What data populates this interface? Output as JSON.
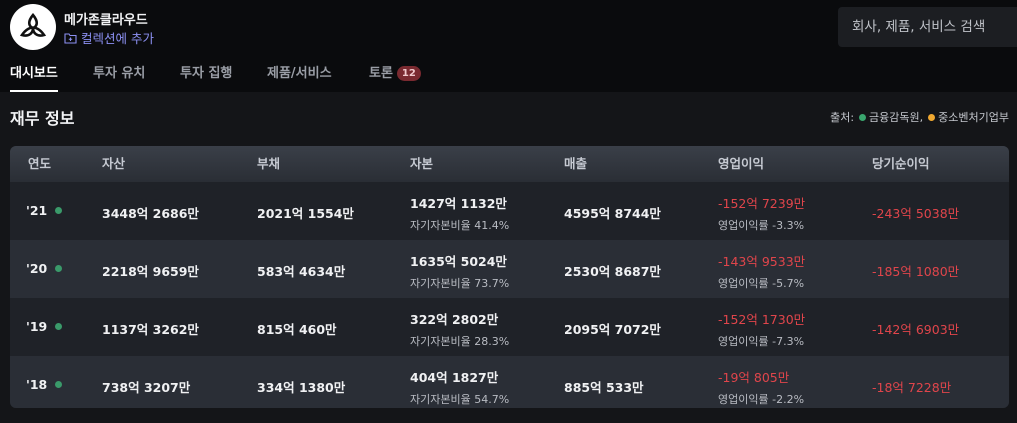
{
  "header": {
    "company_name": "메가존클라우드",
    "add_collection_label": "컬렉션에 추가",
    "search_placeholder": "회사, 제품, 서비스 검색"
  },
  "tabs": [
    {
      "label": "대시보드",
      "active": true
    },
    {
      "label": "투자 유치"
    },
    {
      "label": "투자 집행"
    },
    {
      "label": "제품/서비스"
    },
    {
      "label": "토론",
      "badge": "12"
    }
  ],
  "section": {
    "title": "재무 정보",
    "source_label": "출처:",
    "sources": [
      {
        "name": "금융감독원,",
        "color": "#3aa66e"
      },
      {
        "name": "중소벤처기업부",
        "color": "#f0a830"
      }
    ]
  },
  "table": {
    "columns": [
      "연도",
      "자산",
      "부채",
      "자본",
      "매출",
      "영업이익",
      "당기순이익"
    ],
    "equity_ratio_label": "자기자본비율",
    "op_margin_label": "영업이익률",
    "rows": [
      {
        "year": "'21",
        "assets": "3448억 2686만",
        "liabilities": "2021억 1554만",
        "equity": "1427억 1132만",
        "equity_ratio": "41.4%",
        "revenue": "4595억 8744만",
        "op_income": "-152억 7239만",
        "op_margin": "-3.3%",
        "net_income": "-243억 5038만"
      },
      {
        "year": "'20",
        "assets": "2218억 9659만",
        "liabilities": "583억 4634만",
        "equity": "1635억 5024만",
        "equity_ratio": "73.7%",
        "revenue": "2530억 8687만",
        "op_income": "-143억 9533만",
        "op_margin": "-5.7%",
        "net_income": "-185억 1080만"
      },
      {
        "year": "'19",
        "assets": "1137억 3262만",
        "liabilities": "815억 460만",
        "equity": "322억 2802만",
        "equity_ratio": "28.3%",
        "revenue": "2095억 7072만",
        "op_income": "-152억 1730만",
        "op_margin": "-7.3%",
        "net_income": "-142억 6903만"
      },
      {
        "year": "'18",
        "assets": "738억 3207만",
        "liabilities": "334억 1380만",
        "equity": "404억 1827만",
        "equity_ratio": "54.7%",
        "revenue": "885억 533만",
        "op_income": "-19억 805만",
        "op_margin": "-2.2%",
        "net_income": "-18억 7228만"
      }
    ]
  }
}
